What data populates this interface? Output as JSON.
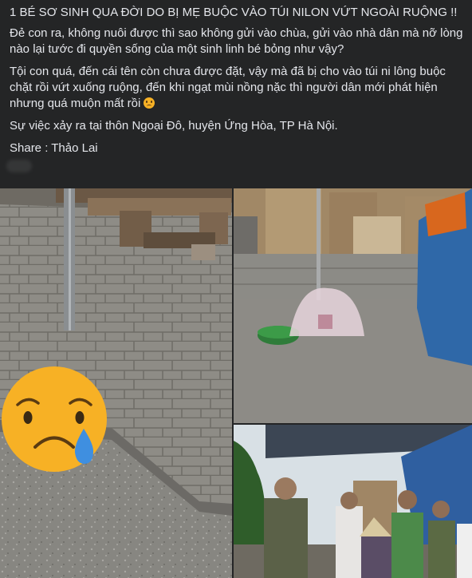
{
  "post": {
    "paragraphs": [
      "1 BÉ SƠ SINH QUA ĐỜI DO BỊ MẸ BUỘC VÀO TÚI NILON VỨT NGOÀI RUỘNG !!",
      "Đẻ con ra, không nuôi được thì sao không gửi vào chùa, gửi vào nhà dân mà nỡ lòng nào lại tước đi quyền sống  của một sinh linh bé bỏng như vậy?",
      "Tội con quá, đến cái tên còn chưa được đặt, vậy mà đã bị cho vào túi ni lông buộc chặt rồi vứt xuống ruộng, đến khi ngạt mùi nồng nặc thì người dân mới phát hiện nhưng quá muộn mất rồi",
      "Sự việc xảy ra tại thôn Ngoại Đô, huyện Ứng Hòa, TP Hà Nội.",
      "Share : Thảo Lai"
    ],
    "inline_emoji": "sad-face-icon"
  },
  "photos": {
    "left": {
      "overlay_emoji": "crying-face-icon"
    },
    "top_right": {},
    "bottom_right": {}
  },
  "colors": {
    "background": "#242526",
    "text": "#e4e6eb",
    "emoji_yellow": "#f7b125",
    "tear_blue": "#3f8fe0"
  }
}
